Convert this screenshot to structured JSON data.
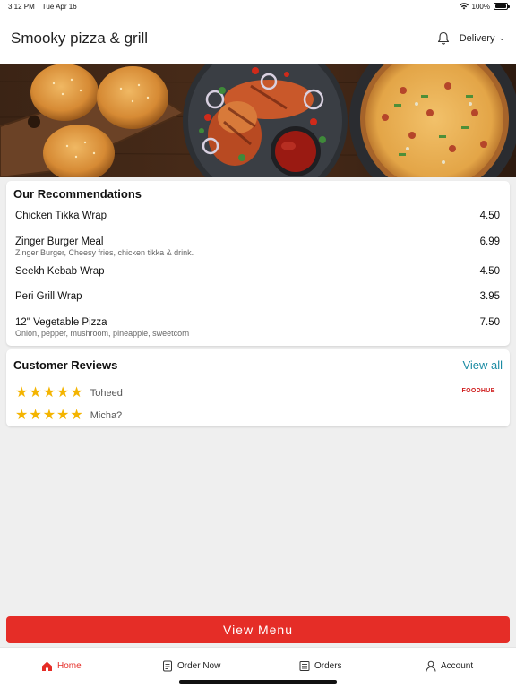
{
  "status_bar": {
    "time": "3:12 PM",
    "date": "Tue Apr 16",
    "battery": "100%",
    "battery_level": 1.0
  },
  "header": {
    "title": "Smooky pizza & grill",
    "mode_label": "Delivery",
    "bell_icon": "bell-icon",
    "chevron_icon": "chevron-down-icon"
  },
  "banner": {
    "image": "food-banner-burgers-grill-pizza"
  },
  "recommendations": {
    "title": "Our Recommendations",
    "items": [
      {
        "name": "Chicken Tikka Wrap",
        "desc": "",
        "price": "4.50"
      },
      {
        "name": "Zinger Burger Meal",
        "desc": "Zinger Burger, Cheesy fries,  chicken tikka & drink.",
        "price": "6.99"
      },
      {
        "name": "Seekh Kebab Wrap",
        "desc": "",
        "price": "4.50"
      },
      {
        "name": "Peri Grill Wrap",
        "desc": "",
        "price": "3.95"
      },
      {
        "name": "12\" Vegetable Pizza",
        "desc": "Onion, pepper, mushroom, pineapple, sweetcorn",
        "price": "7.50"
      }
    ]
  },
  "reviews": {
    "title": "Customer Reviews",
    "view_all": "View all",
    "brand": "FOODHUB",
    "items": [
      {
        "name": "Toheed",
        "rating": 5
      },
      {
        "name": "Micha?",
        "rating": 5
      }
    ]
  },
  "view_menu_label": "View Menu",
  "tabs": [
    {
      "label": "Home",
      "icon": "home-icon",
      "active": true
    },
    {
      "label": "Order Now",
      "icon": "order-icon",
      "active": false
    },
    {
      "label": "Orders",
      "icon": "orders-icon",
      "active": false
    },
    {
      "label": "Account",
      "icon": "account-icon",
      "active": false
    }
  ],
  "colors": {
    "accent": "#e52d27",
    "link": "#1a8ba3",
    "star": "#f4b400"
  }
}
